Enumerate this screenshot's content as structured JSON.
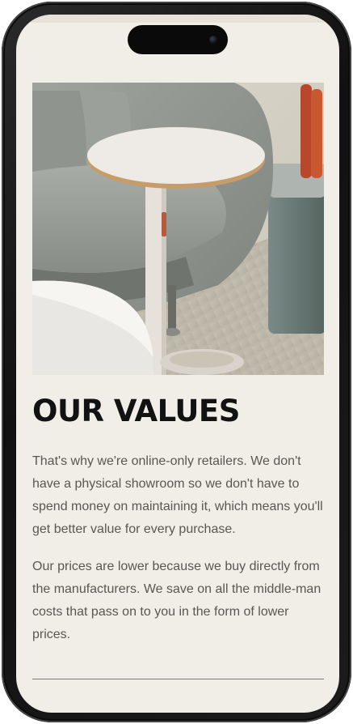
{
  "page": {
    "heading": "OUR VALUES",
    "paragraphs": [
      "That's why we're online-only retailers. We don't have a physical showroom so we don't have to spend money on maintaining it, which means you'll get better value for every purchase.",
      "Our prices are lower because we buy directly from the manufacturers. We save on all the middle-man costs that pass on to you in the form of lower prices."
    ]
  },
  "hero_image": {
    "subject": "grey armchair with white side table"
  },
  "colors": {
    "background": "#f1eee8",
    "heading": "#121212",
    "body_text": "#5a5650",
    "divider": "#7c7a74",
    "device_frame": "#161616"
  }
}
